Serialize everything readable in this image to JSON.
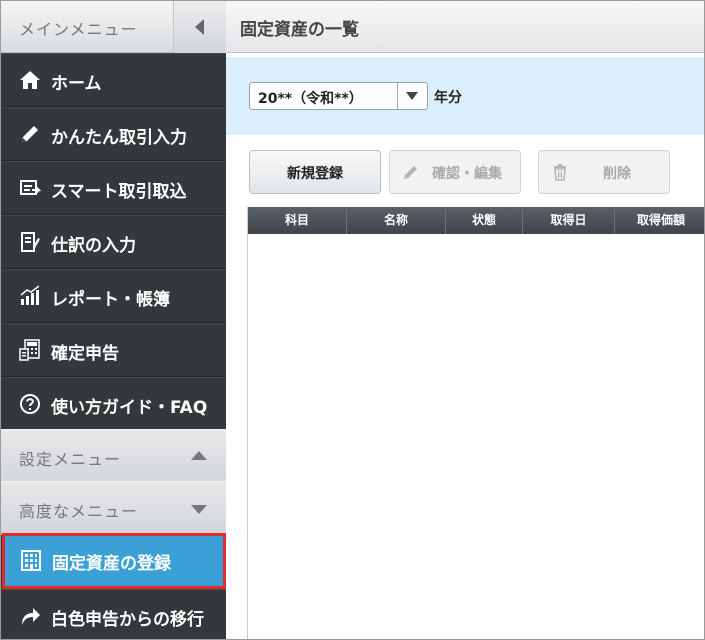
{
  "sidebar": {
    "header_title": "メインメニュー",
    "nav_items": [
      {
        "label": "ホーム",
        "icon": "home-icon"
      },
      {
        "label": "かんたん取引入力",
        "icon": "pencil-icon"
      },
      {
        "label": "スマート取引取込",
        "icon": "import-icon"
      },
      {
        "label": "仕訳の入力",
        "icon": "journal-icon"
      },
      {
        "label": "レポート・帳簿",
        "icon": "chart-icon"
      },
      {
        "label": "確定申告",
        "icon": "calculator-icon"
      },
      {
        "label": "使い方ガイド・FAQ",
        "icon": "help-icon"
      }
    ],
    "settings_menu_label": "設定メニュー",
    "advanced_menu_label": "高度なメニュー",
    "active_item": {
      "label": "固定資産の登録",
      "icon": "building-icon"
    },
    "last_item": {
      "label": "白色申告からの移行",
      "icon": "arrow-icon"
    }
  },
  "main": {
    "title": "固定資産の一覧",
    "year_select": {
      "value": "20**（令和**）",
      "suffix": "年分"
    },
    "buttons": {
      "new": "新規登録",
      "edit": "確認・編集",
      "delete": "削除"
    },
    "table_headers": [
      "科目",
      "名称",
      "状態",
      "取得日",
      "取得価額"
    ]
  },
  "colors": {
    "sidebar_bg": "#33383b",
    "active_bg": "#3aa0d6",
    "highlight_border": "#e32a2a",
    "filter_bg": "#dbeefb"
  }
}
